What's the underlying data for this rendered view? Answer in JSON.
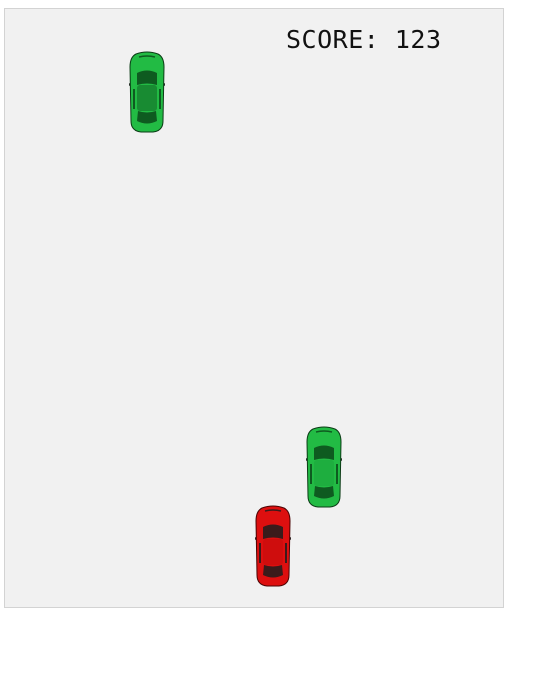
{
  "hud": {
    "score_label": "SCORE:",
    "score_value": "123"
  },
  "cars": {
    "enemy_color": "#22bb44",
    "enemy_dark": "#0e5b20",
    "player_color": "#dd0f0f",
    "player_dark": "#3a1b1b"
  },
  "icons": {
    "enemy_car": "green-car-icon",
    "player_car": "red-car-icon"
  }
}
